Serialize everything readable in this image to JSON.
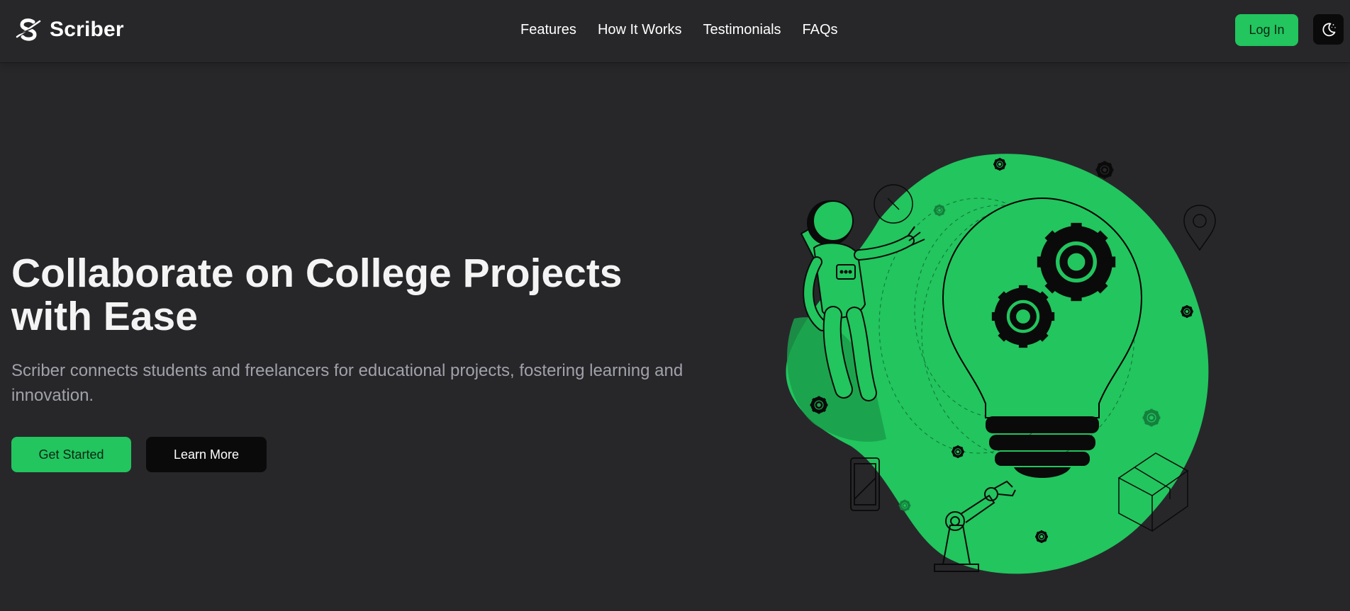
{
  "brand": {
    "name": "Scriber",
    "icon": "scriber-logo-icon"
  },
  "nav": {
    "links": [
      "Features",
      "How It Works",
      "Testimonials",
      "FAQs"
    ],
    "login_label": "Log In",
    "theme_toggle_icon": "moon-icon"
  },
  "hero": {
    "title": "Collaborate on College Projects with Ease",
    "description": "Scriber connects students and freelancers for educational projects, fostering learning and innovation.",
    "primary_cta": "Get Started",
    "secondary_cta": "Learn More",
    "illustration": "astronaut-lightbulb-gears-illustration"
  },
  "colors": {
    "background": "#27272a",
    "accent": "#22c55e",
    "dark_button": "#0a0a0a",
    "muted_text": "#a1a1aa"
  }
}
